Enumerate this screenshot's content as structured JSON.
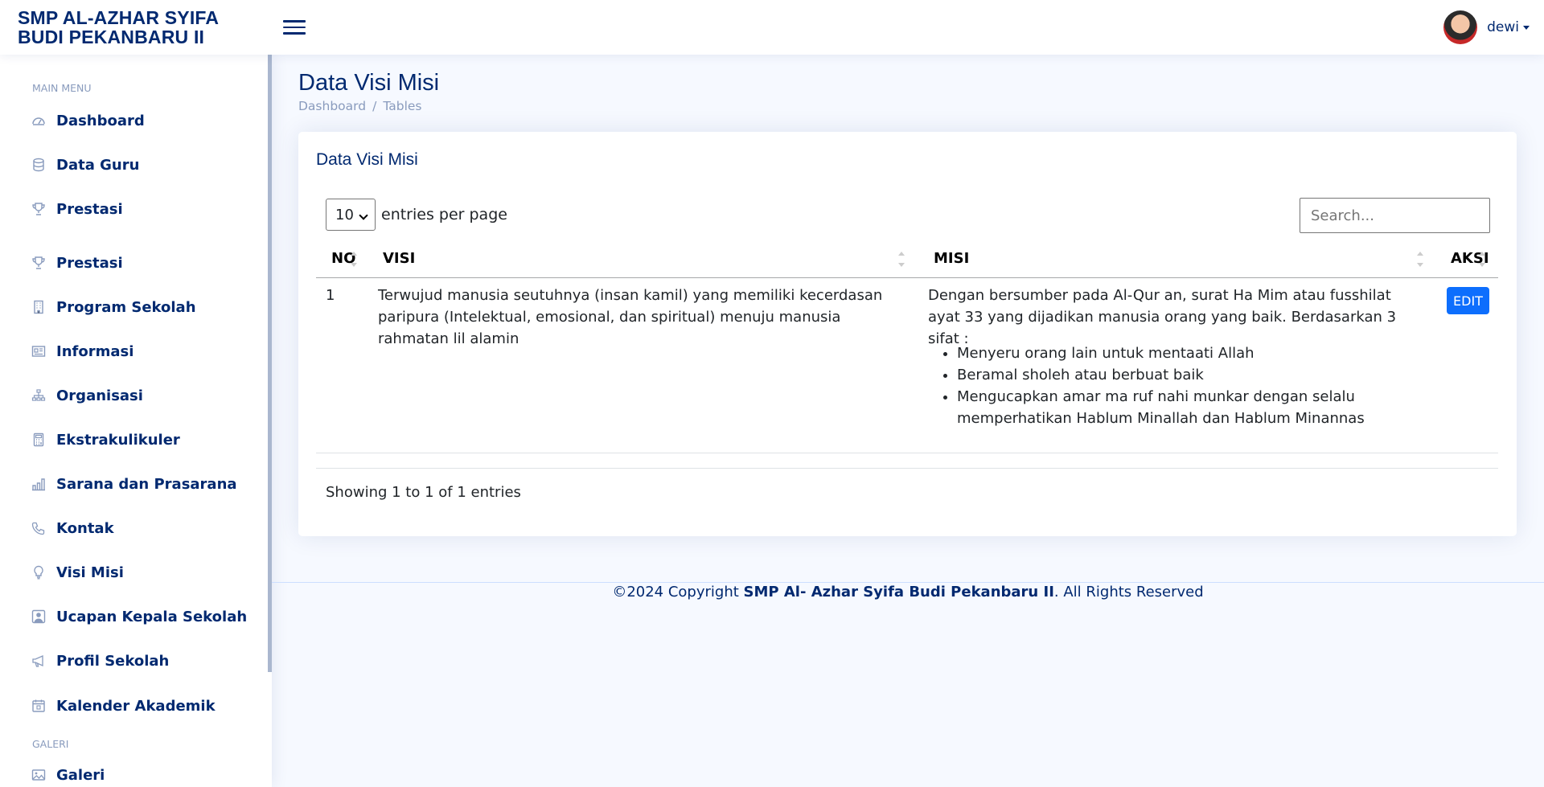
{
  "header": {
    "brand": "SMP AL-AZHAR SYIFA BUDI PEKANBARU II",
    "username": "dewi"
  },
  "sidebar": {
    "heading_main": "MAIN MENU",
    "items": [
      {
        "label": "Dashboard",
        "icon": "speedometer-icon"
      },
      {
        "label": "Data Guru",
        "icon": "database-icon"
      },
      {
        "label": "Prestasi",
        "icon": "trophy-icon"
      },
      {
        "label": "Prestasi",
        "icon": "trophy-icon"
      },
      {
        "label": "Program Sekolah",
        "icon": "building-icon"
      },
      {
        "label": "Informasi",
        "icon": "newspaper-icon"
      },
      {
        "label": "Organisasi",
        "icon": "diagram-icon"
      },
      {
        "label": "Ekstrakulikuler",
        "icon": "calculator-icon"
      },
      {
        "label": "Sarana dan Prasarana",
        "icon": "bar-chart-icon"
      },
      {
        "label": "Kontak",
        "icon": "telephone-icon"
      },
      {
        "label": "Visi Misi",
        "icon": "lightbulb-icon"
      },
      {
        "label": "Ucapan Kepala Sekolah",
        "icon": "person-square-icon"
      },
      {
        "label": "Profil Sekolah",
        "icon": "megaphone-icon"
      },
      {
        "label": "Kalender Akademik",
        "icon": "calendar-icon"
      }
    ],
    "heading_gallery": "GALERI",
    "gallery_item": {
      "label": "Galeri",
      "icon": "image-icon"
    }
  },
  "page": {
    "title": "Data Visi Misi",
    "breadcrumb": [
      "Dashboard",
      "Tables"
    ],
    "breadcrumb_sep": "/"
  },
  "card": {
    "title": "Data Visi Misi",
    "per_page_value": "10",
    "per_page_label": "entries per page",
    "search_placeholder": "Search...",
    "columns": [
      "NO",
      "VISI",
      "MISI",
      "AKSI"
    ],
    "rows": [
      {
        "no": "1",
        "visi": "Terwujud manusia seutuhnya (insan kamil) yang memiliki kecerdasan paripura (Intelektual, emosional, dan spiritual) menuju manusia rahmatan lil alamin",
        "misi_intro": "Dengan bersumber pada Al-Qur an, surat Ha Mim atau fusshilat ayat 33 yang dijadikan manusia orang yang baik. Berdasarkan 3 sifat :",
        "misi_points": [
          "Menyeru orang lain untuk mentaati Allah",
          "Beramal sholeh atau berbuat baik",
          "Mengucapkan amar ma ruf nahi munkar dengan selalu memperhatikan Hablum Minallah dan Hablum Minannas"
        ],
        "action": "EDIT"
      }
    ],
    "info": "Showing 1 to 1 of 1 entries"
  },
  "footer": {
    "prefix": "©2024 Copyright ",
    "name": "SMP Al- Azhar Syifa Budi Pekanbaru II",
    "suffix": ". All Rights Reserved"
  },
  "colors": {
    "primary": "#012970",
    "muted": "#899bbd",
    "background": "#f6f9ff",
    "button": "#0d6efd"
  }
}
